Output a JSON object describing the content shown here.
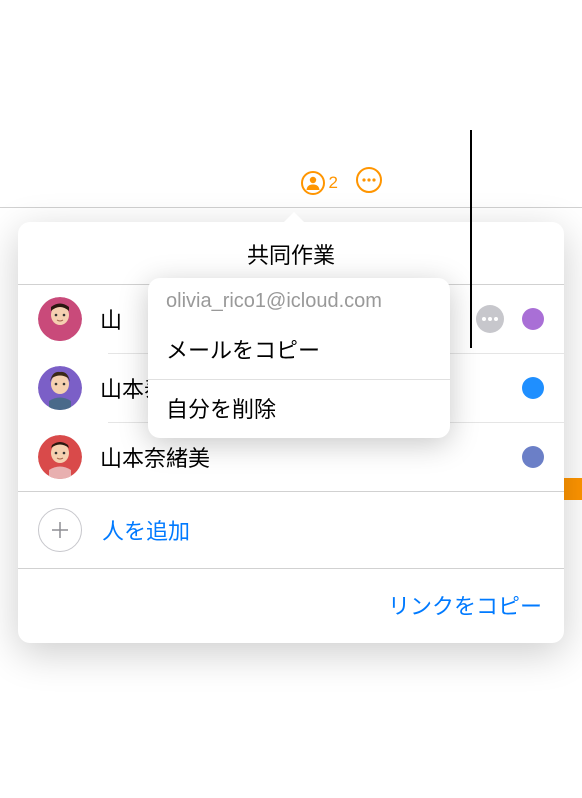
{
  "toolbar": {
    "collaborator_count": "2"
  },
  "popover": {
    "title": "共同作業",
    "people": [
      {
        "name": "山",
        "color": "#a96fd6"
      },
      {
        "name": "山本泰久（オーナー）",
        "color": "#1f8fff"
      },
      {
        "name": "山本奈緒美",
        "color": "#6b7fc7"
      }
    ],
    "add_label": "人を追加",
    "copy_link": "リンクをコピー"
  },
  "context_menu": {
    "email": "olivia_rico1@icloud.com",
    "copy_mail": "メールをコピー",
    "remove_self": "自分を削除"
  }
}
